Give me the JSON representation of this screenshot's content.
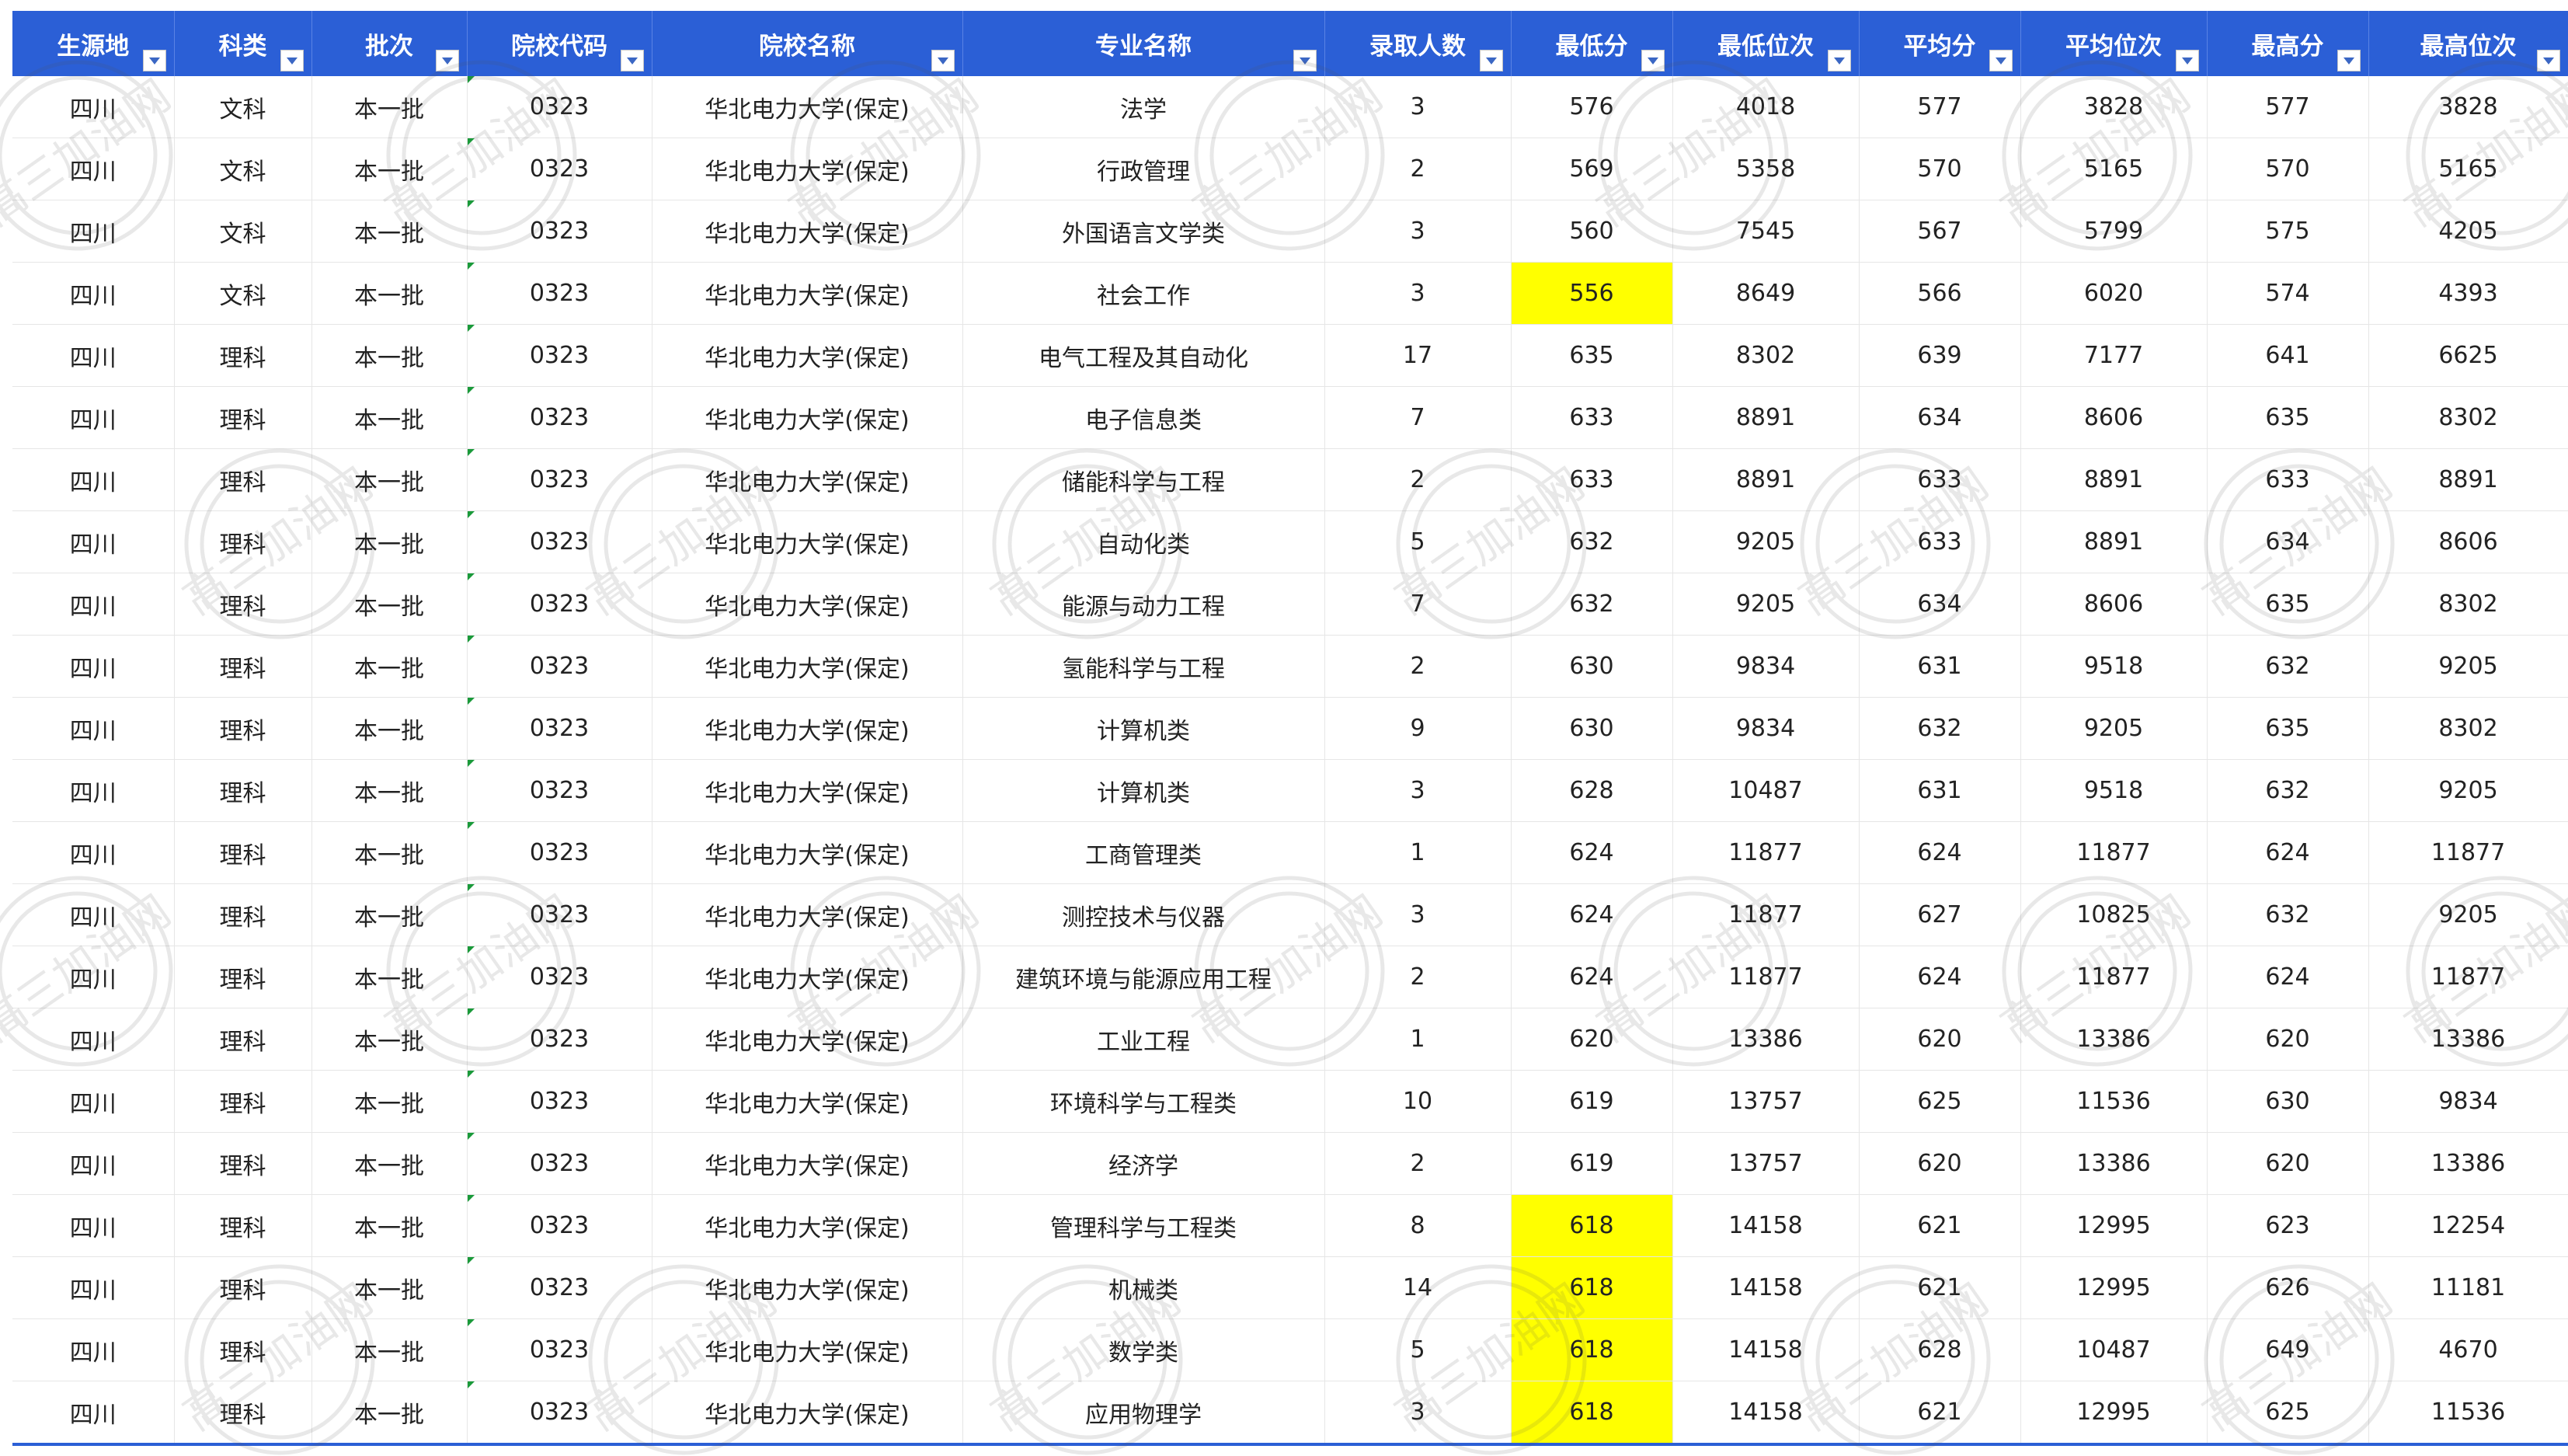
{
  "columns": [
    "生源地",
    "科类",
    "批次",
    "院校代码",
    "院校名称",
    "专业名称",
    "录取人数",
    "最低分",
    "最低位次",
    "平均分",
    "平均位次",
    "最高分",
    "最高位次"
  ],
  "watermark_text": "高三加油网",
  "highlight_color": "#ffff00",
  "header_color": "#2b5fd6",
  "rows": [
    [
      "四川",
      "文科",
      "本一批",
      "0323",
      "华北电力大学(保定)",
      "法学",
      "3",
      "576",
      "4018",
      "577",
      "3828",
      "577",
      "3828"
    ],
    [
      "四川",
      "文科",
      "本一批",
      "0323",
      "华北电力大学(保定)",
      "行政管理",
      "2",
      "569",
      "5358",
      "570",
      "5165",
      "570",
      "5165"
    ],
    [
      "四川",
      "文科",
      "本一批",
      "0323",
      "华北电力大学(保定)",
      "外国语言文学类",
      "3",
      "560",
      "7545",
      "567",
      "5799",
      "575",
      "4205"
    ],
    [
      "四川",
      "文科",
      "本一批",
      "0323",
      "华北电力大学(保定)",
      "社会工作",
      "3",
      "556",
      "8649",
      "566",
      "6020",
      "574",
      "4393"
    ],
    [
      "四川",
      "理科",
      "本一批",
      "0323",
      "华北电力大学(保定)",
      "电气工程及其自动化",
      "17",
      "635",
      "8302",
      "639",
      "7177",
      "641",
      "6625"
    ],
    [
      "四川",
      "理科",
      "本一批",
      "0323",
      "华北电力大学(保定)",
      "电子信息类",
      "7",
      "633",
      "8891",
      "634",
      "8606",
      "635",
      "8302"
    ],
    [
      "四川",
      "理科",
      "本一批",
      "0323",
      "华北电力大学(保定)",
      "储能科学与工程",
      "2",
      "633",
      "8891",
      "633",
      "8891",
      "633",
      "8891"
    ],
    [
      "四川",
      "理科",
      "本一批",
      "0323",
      "华北电力大学(保定)",
      "自动化类",
      "5",
      "632",
      "9205",
      "633",
      "8891",
      "634",
      "8606"
    ],
    [
      "四川",
      "理科",
      "本一批",
      "0323",
      "华北电力大学(保定)",
      "能源与动力工程",
      "7",
      "632",
      "9205",
      "634",
      "8606",
      "635",
      "8302"
    ],
    [
      "四川",
      "理科",
      "本一批",
      "0323",
      "华北电力大学(保定)",
      "氢能科学与工程",
      "2",
      "630",
      "9834",
      "631",
      "9518",
      "632",
      "9205"
    ],
    [
      "四川",
      "理科",
      "本一批",
      "0323",
      "华北电力大学(保定)",
      "计算机类",
      "9",
      "630",
      "9834",
      "632",
      "9205",
      "635",
      "8302"
    ],
    [
      "四川",
      "理科",
      "本一批",
      "0323",
      "华北电力大学(保定)",
      "计算机类",
      "3",
      "628",
      "10487",
      "631",
      "9518",
      "632",
      "9205"
    ],
    [
      "四川",
      "理科",
      "本一批",
      "0323",
      "华北电力大学(保定)",
      "工商管理类",
      "1",
      "624",
      "11877",
      "624",
      "11877",
      "624",
      "11877"
    ],
    [
      "四川",
      "理科",
      "本一批",
      "0323",
      "华北电力大学(保定)",
      "测控技术与仪器",
      "3",
      "624",
      "11877",
      "627",
      "10825",
      "632",
      "9205"
    ],
    [
      "四川",
      "理科",
      "本一批",
      "0323",
      "华北电力大学(保定)",
      "建筑环境与能源应用工程",
      "2",
      "624",
      "11877",
      "624",
      "11877",
      "624",
      "11877"
    ],
    [
      "四川",
      "理科",
      "本一批",
      "0323",
      "华北电力大学(保定)",
      "工业工程",
      "1",
      "620",
      "13386",
      "620",
      "13386",
      "620",
      "13386"
    ],
    [
      "四川",
      "理科",
      "本一批",
      "0323",
      "华北电力大学(保定)",
      "环境科学与工程类",
      "10",
      "619",
      "13757",
      "625",
      "11536",
      "630",
      "9834"
    ],
    [
      "四川",
      "理科",
      "本一批",
      "0323",
      "华北电力大学(保定)",
      "经济学",
      "2",
      "619",
      "13757",
      "620",
      "13386",
      "620",
      "13386"
    ],
    [
      "四川",
      "理科",
      "本一批",
      "0323",
      "华北电力大学(保定)",
      "管理科学与工程类",
      "8",
      "618",
      "14158",
      "621",
      "12995",
      "623",
      "12254"
    ],
    [
      "四川",
      "理科",
      "本一批",
      "0323",
      "华北电力大学(保定)",
      "机械类",
      "14",
      "618",
      "14158",
      "621",
      "12995",
      "626",
      "11181"
    ],
    [
      "四川",
      "理科",
      "本一批",
      "0323",
      "华北电力大学(保定)",
      "数学类",
      "5",
      "618",
      "14158",
      "628",
      "10487",
      "649",
      "4670"
    ],
    [
      "四川",
      "理科",
      "本一批",
      "0323",
      "华北电力大学(保定)",
      "应用物理学",
      "3",
      "618",
      "14158",
      "621",
      "12995",
      "625",
      "11536"
    ]
  ],
  "highlighted_rows": [
    3,
    18,
    19,
    20,
    21
  ],
  "highlighted_column": 7
}
